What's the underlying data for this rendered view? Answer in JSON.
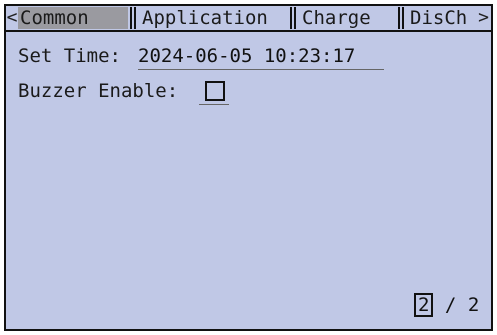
{
  "tabs": {
    "left_arrow": "<",
    "right_arrow": ">",
    "items": [
      {
        "label": "Common"
      },
      {
        "label": "Application"
      },
      {
        "label": "Charge"
      },
      {
        "label": "DisCh"
      }
    ],
    "active_index": 0
  },
  "settings": {
    "set_time_label": "Set Time:",
    "set_time_value": "2024-06-05 10:23:17",
    "buzzer_label": "Buzzer Enable:",
    "buzzer_checked": false
  },
  "pager": {
    "current": "2",
    "separator": "/",
    "total": "2"
  },
  "colors": {
    "screen_bg": "#c0c8e6",
    "active_tab_bg": "#9a9aa0",
    "border": "#111111"
  }
}
